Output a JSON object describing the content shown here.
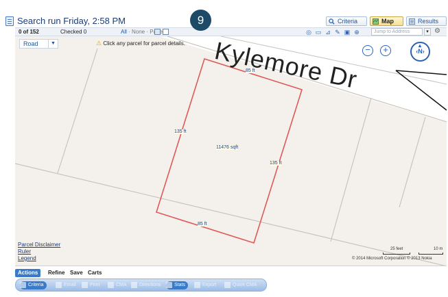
{
  "header": {
    "title": "Search run Friday, 2:58 PM",
    "step_badge": "9",
    "view_buttons": {
      "criteria": "Criteria",
      "map": "Map",
      "results": "Results"
    }
  },
  "toolbar": {
    "count": "0 of 152",
    "checked": "Checked 0",
    "select_all": "All",
    "select_none": "None",
    "select_page": "Page",
    "jump_placeholder": "Jump to Address"
  },
  "map": {
    "layer_select": "Road",
    "hint": "Click any parcel for parcel details.",
    "street_name": "Kylemore Dr",
    "parcel": {
      "top_dim": "85 ft",
      "bottom_dim": "85 ft",
      "left_dim": "135 ft",
      "right_dim": "135 ft",
      "area": "11476 sqft",
      "outline_color": "#e05858"
    },
    "links": [
      "Parcel Disclaimer",
      "Ruler",
      "Legend"
    ],
    "scale_feet": "25 feet",
    "scale_meters": "10 m",
    "copyright": "© 2014 Microsoft Corporation   © 2013 Nokia"
  },
  "actions": {
    "tabs": [
      "Actions",
      "Refine",
      "Save",
      "Carts"
    ],
    "buttons": [
      "Criteria",
      "Email",
      "Print",
      "CMA",
      "Directions",
      "Stats",
      "Export",
      "Quick CMA"
    ]
  },
  "colors": {
    "accent": "#3b7ac7",
    "title": "#1a3c78",
    "badge": "#1d4a66"
  }
}
